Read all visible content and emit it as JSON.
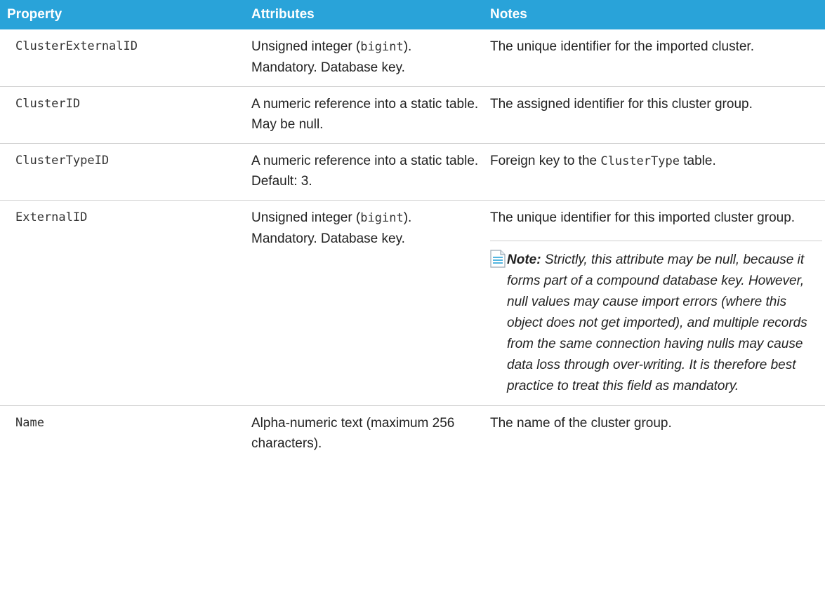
{
  "table": {
    "headers": [
      "Property",
      "Attributes",
      "Notes"
    ],
    "rows": [
      {
        "property": "ClusterExternalID",
        "attr_pre": "Unsigned integer (",
        "attr_code": "bigint",
        "attr_post": "). Mandatory. Database key.",
        "notes": "The unique identifier for the imported cluster."
      },
      {
        "property": "ClusterID",
        "attributes": "A numeric reference into a static table. May be null.",
        "notes": "The assigned identifier for this cluster group."
      },
      {
        "property": "ClusterTypeID",
        "attributes": "A numeric reference into a static table. Default: 3.",
        "notes_pre": "Foreign key to the ",
        "notes_code": "ClusterType",
        "notes_post": " table."
      },
      {
        "property": "ExternalID",
        "attr_pre": "Unsigned integer (",
        "attr_code": "bigint",
        "attr_post": "). Mandatory. Database key.",
        "notes": "The unique identifier for this imported cluster group.",
        "note_icon": "note-document-icon",
        "note_label": "Note:",
        "note_text": "Strictly, this attribute may be null, because it forms part of a compound database key. However, null values may cause import errors (where this object does not get imported), and multiple records from the same connection having nulls may cause data loss through over-writing. It is therefore best practice to treat this field as mandatory."
      },
      {
        "property": "Name",
        "attributes": "Alpha-numeric text (maximum 256 characters).",
        "notes": "The name of the cluster group."
      }
    ]
  },
  "colors": {
    "header_bg": "#29a3d9",
    "header_text": "#ffffff",
    "rule": "#cfcfcf"
  }
}
